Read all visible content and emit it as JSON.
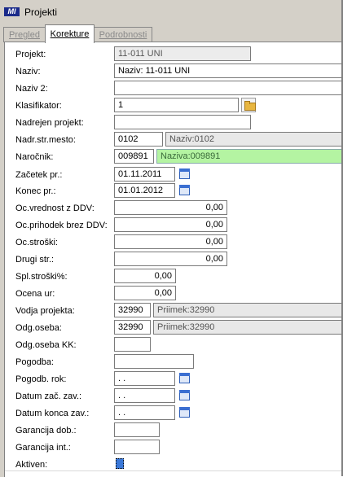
{
  "window": {
    "title": "Projekti",
    "logo_text": "MI"
  },
  "tabs": [
    {
      "label": "Pregled",
      "active": false
    },
    {
      "label": "Korekture",
      "active": true
    },
    {
      "label": "Podrobnosti",
      "active": false
    }
  ],
  "form": {
    "projekt": {
      "label": "Projekt:",
      "value": "11-011 UNI"
    },
    "naziv": {
      "label": "Naziv:",
      "value": "Naziv: 11-011 UNI"
    },
    "naziv2": {
      "label": "Naziv 2:",
      "value": ""
    },
    "klasifikator": {
      "label": "Klasifikator:",
      "value": "1"
    },
    "nadrejen_projekt": {
      "label": "Nadrejen projekt:",
      "value": ""
    },
    "nadr_str_mesto": {
      "label": "Nadr.str.mesto:",
      "value": "0102",
      "name": "Naziv:0102"
    },
    "narocnik": {
      "label": "Naročnik:",
      "value": "009891",
      "name": "Naziva:009891"
    },
    "zacetek": {
      "label": "Začetek pr.:",
      "value": "01.11.2011"
    },
    "konec": {
      "label": "Konec pr.:",
      "value": "01.01.2012"
    },
    "oc_vrednost": {
      "label": "Oc.vrednost z DDV:",
      "value": "0,00"
    },
    "oc_prihodek": {
      "label": "Oc.prihodek brez DDV:",
      "value": "0,00"
    },
    "oc_stroski": {
      "label": "Oc.stroški:",
      "value": "0,00"
    },
    "drugi_str": {
      "label": "Drugi str.:",
      "value": "0,00"
    },
    "spl_stroski": {
      "label": "Spl.stroški%:",
      "value": "0,00"
    },
    "ocena_ur": {
      "label": "Ocena ur:",
      "value": "0,00"
    },
    "vodja": {
      "label": "Vodja projekta:",
      "value": "32990",
      "name": "Priimek:32990"
    },
    "odg_oseba": {
      "label": "Odg.oseba:",
      "value": "32990",
      "name": "Priimek:32990"
    },
    "odg_oseba_kk": {
      "label": "Odg.oseba KK:",
      "value": ""
    },
    "pogodba": {
      "label": "Pogodba:",
      "value": ""
    },
    "pogodb_rok": {
      "label": "Pogodb. rok:",
      "value": " .  . "
    },
    "datum_zac": {
      "label": "Datum zač. zav.:",
      "value": " .  . "
    },
    "datum_konca": {
      "label": "Datum konca zav.:",
      "value": " .  . "
    },
    "garancija_dob": {
      "label": "Garancija dob.:",
      "value": ""
    },
    "garancija_int": {
      "label": "Garancija int.:",
      "value": ""
    },
    "aktiven": {
      "label": "Aktiven:",
      "checked": true
    }
  },
  "icons": {
    "browse": "folder-icon",
    "date": "calendar-icon"
  }
}
